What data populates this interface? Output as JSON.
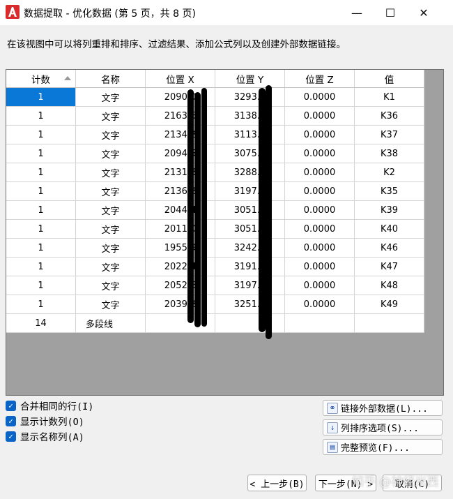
{
  "window": {
    "title": "数据提取 - 优化数据 (第 5 页，共 8 页)",
    "minimize_glyph": "—",
    "maximize_glyph": "☐",
    "close_glyph": "✕"
  },
  "intro_text": "在该视图中可以将列重排和排序、过滤结果、添加公式列以及创建外部数据链接。",
  "grid": {
    "columns": [
      "计数",
      "名称",
      "位置 X",
      "位置 Y",
      "位置 Z",
      "值"
    ],
    "rows": [
      [
        "1",
        "文字",
        "2090.0",
        "3293.7",
        "0.0000",
        "K1"
      ],
      [
        "1",
        "文字",
        "2163.6",
        "3138.1",
        "0.0000",
        "K36"
      ],
      [
        "1",
        "文字",
        "2134.2",
        "3113.3",
        "0.0000",
        "K37"
      ],
      [
        "1",
        "文字",
        "2094.5",
        "3075.2",
        "0.0000",
        "K38"
      ],
      [
        "1",
        "文字",
        "2131.8",
        "3288.9",
        "0.0000",
        "K2"
      ],
      [
        "1",
        "文字",
        "2136.2",
        "3197.0",
        "0.0000",
        "K35"
      ],
      [
        "1",
        "文字",
        "2044.4",
        "3051.9",
        "0.0000",
        "K39"
      ],
      [
        "1",
        "文字",
        "2011.0",
        "3051.5",
        "0.0000",
        "K40"
      ],
      [
        "1",
        "文字",
        "1955.9",
        "3242.4",
        "0.0000",
        "K46"
      ],
      [
        "1",
        "文字",
        "2022.4",
        "3191.4",
        "0.0000",
        "K47"
      ],
      [
        "1",
        "文字",
        "2052.6",
        "3197.8",
        "0.0000",
        "K48"
      ],
      [
        "1",
        "文字",
        "2039.2",
        "3251.5",
        "0.0000",
        "K49"
      ],
      [
        "14",
        "多段线",
        "",
        "",
        "",
        ""
      ]
    ]
  },
  "checkboxes": [
    {
      "label": "合并相同的行(I)",
      "checked": true
    },
    {
      "label": "显示计数列(O)",
      "checked": true
    },
    {
      "label": "显示名称列(A)",
      "checked": true
    }
  ],
  "side_buttons": [
    {
      "label": "链接外部数据(L)...",
      "icon": "link-icon"
    },
    {
      "label": "列排序选项(S)...",
      "icon": "sort-az-icon"
    },
    {
      "label": "完整预览(F)...",
      "icon": "preview-icon"
    }
  ],
  "nav": {
    "back": "< 上一步(B)",
    "next": "下一步(N) >",
    "cancel": "取消(C)"
  },
  "watermark": "知乎 @神经米西",
  "colors": {
    "selection": "#0a78d7",
    "accent_red": "#d92b2b"
  }
}
